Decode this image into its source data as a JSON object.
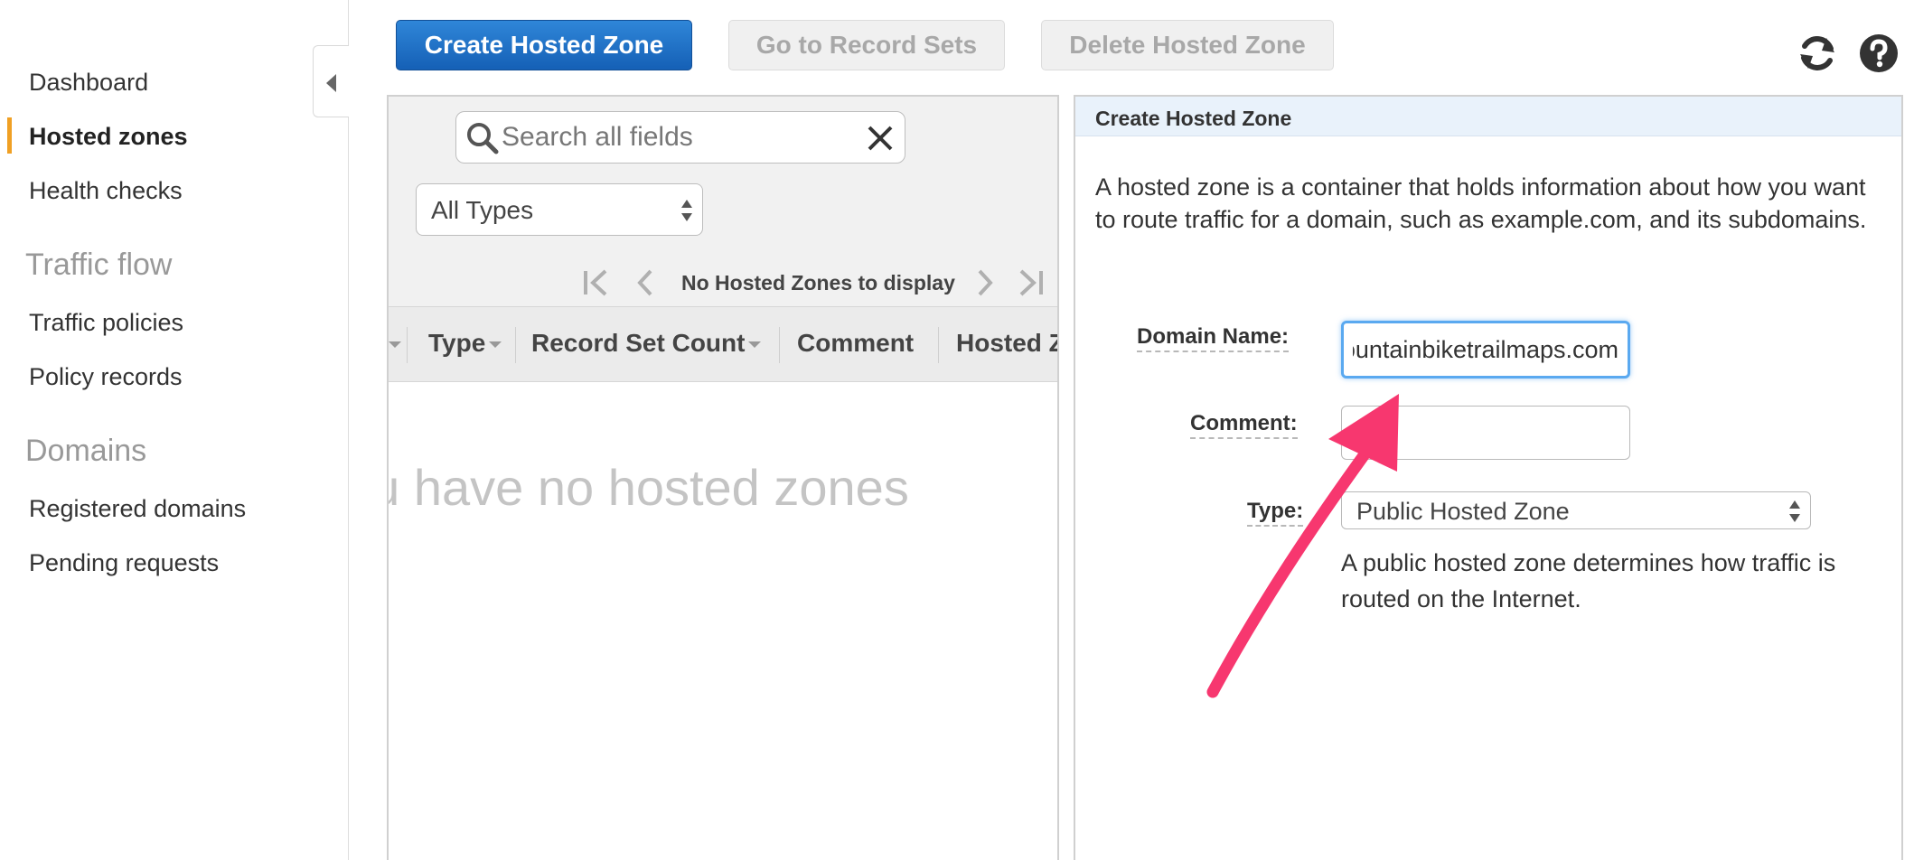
{
  "sidebar": {
    "items": [
      {
        "label": "Dashboard"
      },
      {
        "label": "Hosted zones",
        "active": true
      },
      {
        "label": "Health checks"
      },
      {
        "label": "Traffic policies"
      },
      {
        "label": "Policy records"
      },
      {
        "label": "Registered domains"
      },
      {
        "label": "Pending requests"
      }
    ],
    "headings": [
      "Traffic flow",
      "Domains"
    ],
    "active_accent": "#f0a024"
  },
  "toolbar": {
    "create_label": "Create Hosted Zone",
    "record_sets_label": "Go to Record Sets",
    "delete_label": "Delete Hosted Zone",
    "icons": [
      "refresh-icon",
      "help-icon"
    ],
    "primary_color": "#1f70c8"
  },
  "list": {
    "search_placeholder": "Search all fields",
    "type_filter": "All Types",
    "pager_text": "No Hosted Zones to display",
    "columns": [
      "Type",
      "Record Set Count",
      "Comment",
      "Hosted Z"
    ],
    "empty_message": "ou have no hosted zones"
  },
  "form": {
    "title": "Create Hosted Zone",
    "description": "A hosted zone is a container that holds information about how you want to route traffic for a domain, such as example.com, and its subdomains.",
    "domain_label": "Domain Name:",
    "domain_value": "mountainbiketrailmaps.com",
    "domain_visible": "ıtainbiketrailmaps.com",
    "comment_label": "Comment:",
    "comment_value": "",
    "type_label": "Type:",
    "type_value": "Public Hosted Zone",
    "type_help": "A public hosted zone determines how traffic is routed on the Internet."
  },
  "annotation": {
    "arrow_color": "#f7376f"
  }
}
